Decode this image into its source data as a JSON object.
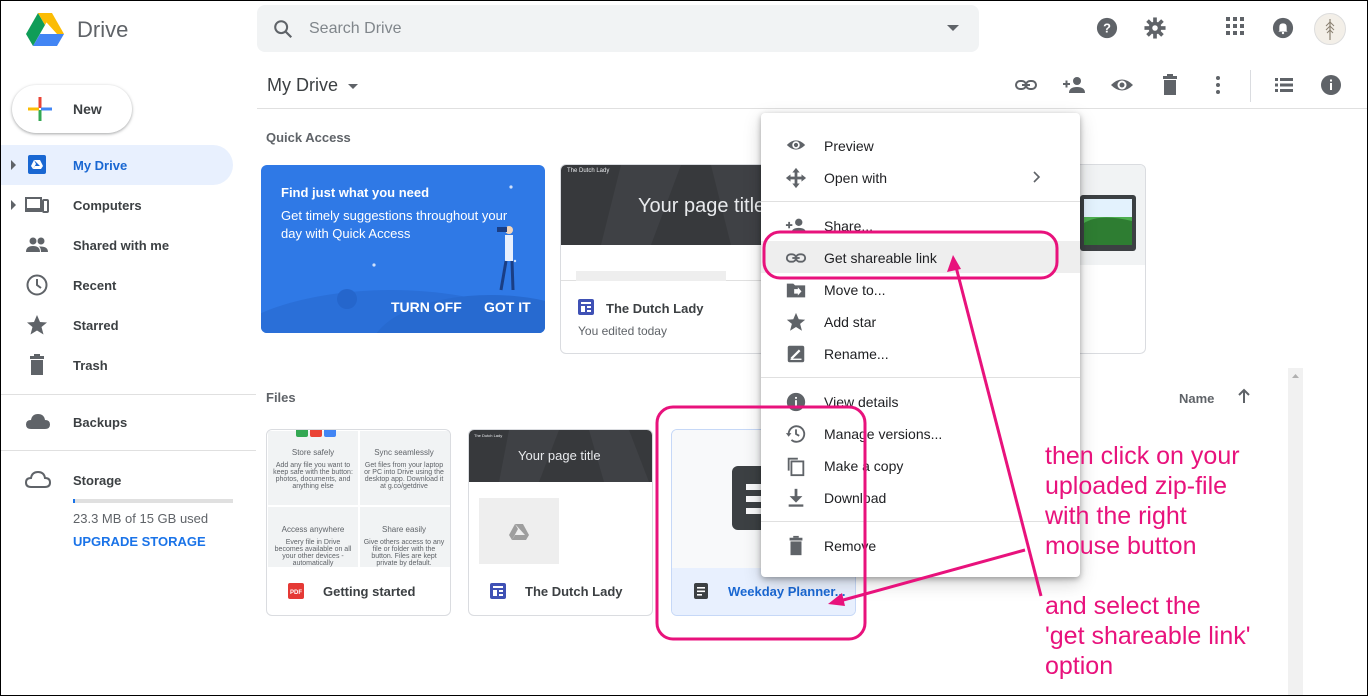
{
  "app": {
    "name": "Drive"
  },
  "search": {
    "placeholder": "Search Drive"
  },
  "header_icons": [
    "help-icon",
    "settings-icon",
    "apps-icon",
    "notifications-icon",
    "account-avatar"
  ],
  "sidebar": {
    "new_label": "New",
    "items": [
      {
        "label": "My Drive",
        "icon": "my-drive-icon",
        "active": true
      },
      {
        "label": "Computers",
        "icon": "computers-icon"
      },
      {
        "label": "Shared with me",
        "icon": "shared-icon"
      },
      {
        "label": "Recent",
        "icon": "clock-icon"
      },
      {
        "label": "Starred",
        "icon": "star-icon"
      },
      {
        "label": "Trash",
        "icon": "trash-icon"
      },
      {
        "label": "Backups",
        "icon": "cloud-icon"
      }
    ],
    "storage": {
      "label": "Storage",
      "usage": "23.3 MB of 15 GB used",
      "used_fraction": 0.0016,
      "upgrade": "UPGRADE STORAGE"
    }
  },
  "toolbar": {
    "title": "My Drive",
    "icons": [
      "link-icon",
      "add-person-icon",
      "preview-icon",
      "delete-icon",
      "more-icon",
      "list-view-icon",
      "info-icon"
    ]
  },
  "quick_access": {
    "label": "Quick Access",
    "promo": {
      "title": "Find just what you need",
      "text": "Get timely suggestions throughout your day with Quick Access",
      "turn_off": "TURN OFF",
      "got_it": "GOT IT"
    },
    "cards": [
      {
        "thumb_title": "Your page title",
        "thumb_brand": "The Dutch Lady",
        "name": "The Dutch Lady",
        "sub": "You edited today"
      }
    ]
  },
  "files": {
    "label": "Files",
    "sort_label": "Name",
    "getting_started": {
      "name": "Getting started",
      "cells": [
        {
          "title": "Store safely",
          "text": "Add any file you want to keep safe with the button: photos, documents, and anything else"
        },
        {
          "title": "Sync seamlessly",
          "text": "Get files from your laptop or PC into Drive using the desktop app. Download it at g.co/getdrive"
        },
        {
          "title": "Access anywhere",
          "text": "Every file in Drive becomes available on all your other devices - automatically"
        },
        {
          "title": "Share easily",
          "text": "Give others access to any file or folder with the button. Files are kept private by default."
        }
      ]
    },
    "dutch_lady": {
      "name": "The Dutch Lady",
      "thumb_title": "Your page title",
      "thumb_brand": "The Dutch Lady"
    },
    "weekday": {
      "name": "Weekday Planner..."
    }
  },
  "context_menu": {
    "groups": [
      [
        {
          "label": "Preview",
          "icon": "eye-icon"
        },
        {
          "label": "Open with",
          "icon": "move-arrows-icon",
          "submenu": true
        }
      ],
      [
        {
          "label": "Share...",
          "icon": "add-person-icon"
        },
        {
          "label": "Get shareable link",
          "icon": "link-icon",
          "highlighted": true
        },
        {
          "label": "Move to...",
          "icon": "move-to-icon"
        },
        {
          "label": "Add star",
          "icon": "star-icon"
        },
        {
          "label": "Rename...",
          "icon": "rename-icon"
        }
      ],
      [
        {
          "label": "View details",
          "icon": "info-icon"
        },
        {
          "label": "Manage versions...",
          "icon": "history-icon"
        },
        {
          "label": "Make a copy",
          "icon": "copy-icon"
        },
        {
          "label": "Download",
          "icon": "download-icon"
        }
      ],
      [
        {
          "label": "Remove",
          "icon": "trash-icon"
        }
      ]
    ]
  },
  "annotations": {
    "instruction_1": [
      "then click on your",
      "uploaded zip-file",
      "with the right",
      "mouse button"
    ],
    "instruction_2": [
      "and select the",
      "'get shareable link'",
      "option"
    ],
    "color": "#e8127c"
  }
}
